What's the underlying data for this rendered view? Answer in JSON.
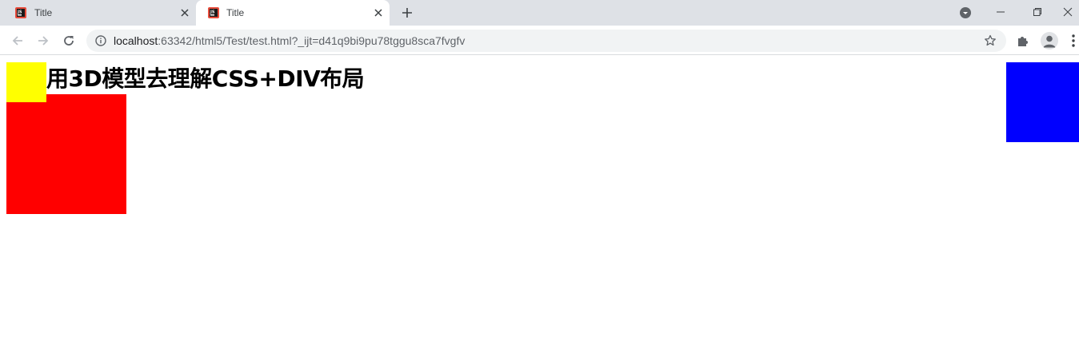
{
  "browser": {
    "tabs": [
      {
        "title": "Title",
        "active": false
      },
      {
        "title": "Title",
        "active": true
      }
    ],
    "address_bar": {
      "host": "localhost",
      "rest": ":63342/html5/Test/test.html?_ijt=d41q9bi9pu78tggu8sca7fvgfv"
    },
    "colors": {
      "tabstrip": "#dee1e6",
      "omnibox": "#f1f3f4",
      "icon": "#5f6368"
    }
  },
  "page": {
    "heading": "用3D模型去理解CSS+DIV布局",
    "boxes": [
      {
        "name": "yellow",
        "color": "#ffff00"
      },
      {
        "name": "red",
        "color": "#ff0000"
      },
      {
        "name": "blue",
        "color": "#0000ff"
      }
    ]
  }
}
